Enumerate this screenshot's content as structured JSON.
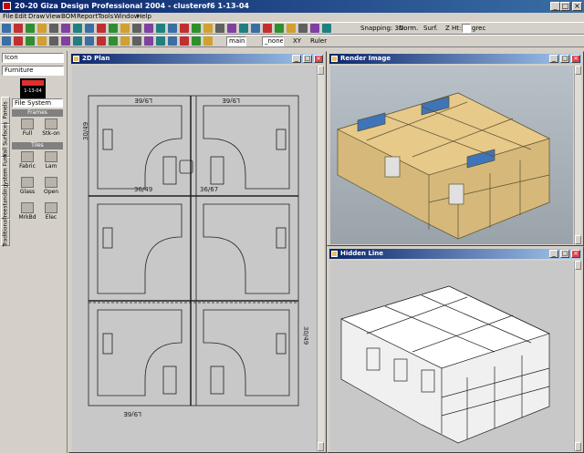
{
  "window": {
    "title": "20-20 Giza Design Professional 2004 - clusterof6 1-13-04",
    "min_label": "_",
    "max_label": "□",
    "close_label": "×"
  },
  "menu": [
    "File",
    "Edit",
    "Draw",
    "View",
    "BOM",
    "Report",
    "Tools",
    "Window",
    "Help"
  ],
  "toolbar": {
    "snapping_label": "Snapping: 3D:",
    "norm_label": "Norm.",
    "surf_label": "Surf.",
    "z_label": "Z Ht:",
    "grec_label": "grec",
    "layer_value": "main",
    "none_value": "_none",
    "xy_label": "XY",
    "ruler_label": "Ruler"
  },
  "left_panel": {
    "view_mode": "Icon",
    "category": "Furniture",
    "version_text": "1-13-04",
    "filter": "File System",
    "section_header": "Frames",
    "tiles_header": "Tiles",
    "tabs": [
      "Panels",
      "Wall Surfaces",
      "System Furn",
      "Freestanding",
      "Traditional"
    ],
    "items": [
      {
        "label": "Full",
        "icon": "full-panel-icon"
      },
      {
        "label": "Stk-on",
        "icon": "stack-on-icon"
      },
      {
        "label": "Fabric",
        "icon": "fabric-tile-icon"
      },
      {
        "label": "Lam",
        "icon": "laminate-tile-icon"
      },
      {
        "label": "Glass",
        "icon": "glass-tile-icon"
      },
      {
        "label": "Open",
        "icon": "open-tile-icon"
      },
      {
        "label": "MrkBd",
        "icon": "markerboard-icon"
      },
      {
        "label": "Elec",
        "icon": "electrical-icon"
      }
    ]
  },
  "windows": {
    "plan": {
      "title": "2D Plan"
    },
    "render": {
      "title": "Render Image"
    },
    "hidden": {
      "title": "Hidden Line"
    }
  },
  "plan_labels": {
    "top_left": "L9/6E",
    "top_right": "L9/6E",
    "side_left": "30/49",
    "side_right": "30/49",
    "mid_a": "36/49",
    "mid_b": "36/67",
    "bottom": "L9/6E"
  },
  "colors": {
    "panel_fill": "#e7c98a",
    "glass": "#3f74b8",
    "frame": "#707050"
  }
}
